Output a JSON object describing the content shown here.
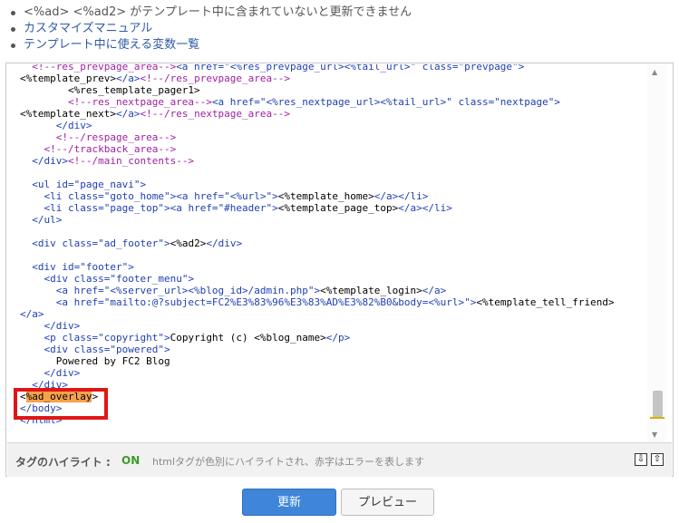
{
  "notes": {
    "warning": "<%ad> <%ad2> がテンプレート中に含まれていないと更新できません",
    "links": [
      "カスタマイズマニュアル",
      "テンプレート中に使える変数一覧"
    ]
  },
  "editor": {
    "lines": [
      {
        "indent": 0,
        "parts": [
          {
            "c": "c",
            "t": "  <!--res_prevpage_area-->"
          },
          {
            "c": "t",
            "t": "<a href="
          },
          {
            "c": "v",
            "t": "\"<%res_prevpage_url><%tail_url>\""
          },
          {
            "c": "t",
            "t": " class="
          },
          {
            "c": "v",
            "t": "\"prevpage\""
          },
          {
            "c": "t",
            "t": ">"
          }
        ]
      },
      {
        "indent": 0,
        "parts": [
          {
            "c": "",
            "t": "<%template_prev>"
          },
          {
            "c": "t",
            "t": "</a>"
          },
          {
            "c": "c",
            "t": "<!--/res_prevpage_area-->"
          }
        ]
      },
      {
        "indent": 0,
        "parts": [
          {
            "c": "",
            "t": "        <%res_template_pager1>"
          }
        ]
      },
      {
        "indent": 0,
        "parts": [
          {
            "c": "c",
            "t": "        <!--res_nextpage_area-->"
          },
          {
            "c": "t",
            "t": "<a href="
          },
          {
            "c": "v",
            "t": "\"<%res_nextpage_url><%tail_url>\""
          },
          {
            "c": "t",
            "t": " class="
          },
          {
            "c": "v",
            "t": "\"nextpage\""
          },
          {
            "c": "t",
            "t": ">"
          }
        ]
      },
      {
        "indent": 0,
        "parts": [
          {
            "c": "",
            "t": "<%template_next>"
          },
          {
            "c": "t",
            "t": "</a>"
          },
          {
            "c": "c",
            "t": "<!--/res_nextpage_area-->"
          }
        ]
      },
      {
        "indent": 0,
        "parts": [
          {
            "c": "t",
            "t": "      </div>"
          }
        ]
      },
      {
        "indent": 0,
        "parts": [
          {
            "c": "c",
            "t": "      <!--/respage_area-->"
          }
        ]
      },
      {
        "indent": 0,
        "parts": [
          {
            "c": "c",
            "t": "    <!--/trackback_area-->"
          }
        ]
      },
      {
        "indent": 0,
        "parts": [
          {
            "c": "t",
            "t": "  </div>"
          },
          {
            "c": "c",
            "t": "<!--/main_contents-->"
          }
        ]
      },
      {
        "indent": 0,
        "parts": []
      },
      {
        "indent": 0,
        "parts": [
          {
            "c": "t",
            "t": "  <ul id="
          },
          {
            "c": "v",
            "t": "\"page_navi\""
          },
          {
            "c": "t",
            "t": ">"
          }
        ]
      },
      {
        "indent": 0,
        "parts": [
          {
            "c": "t",
            "t": "    <li class="
          },
          {
            "c": "v",
            "t": "\"goto_home\""
          },
          {
            "c": "t",
            "t": "><a href="
          },
          {
            "c": "v",
            "t": "\"<%url>\""
          },
          {
            "c": "t",
            "t": ">"
          },
          {
            "c": "",
            "t": "<%template_home>"
          },
          {
            "c": "t",
            "t": "</a></li>"
          }
        ]
      },
      {
        "indent": 0,
        "parts": [
          {
            "c": "t",
            "t": "    <li class="
          },
          {
            "c": "v",
            "t": "\"page_top\""
          },
          {
            "c": "t",
            "t": "><a href="
          },
          {
            "c": "v",
            "t": "\"#header\""
          },
          {
            "c": "t",
            "t": ">"
          },
          {
            "c": "",
            "t": "<%template_page_top>"
          },
          {
            "c": "t",
            "t": "</a></li>"
          }
        ]
      },
      {
        "indent": 0,
        "parts": [
          {
            "c": "t",
            "t": "  </ul>"
          }
        ]
      },
      {
        "indent": 0,
        "parts": []
      },
      {
        "indent": 0,
        "parts": [
          {
            "c": "t",
            "t": "  <div class="
          },
          {
            "c": "v",
            "t": "\"ad_footer\""
          },
          {
            "c": "t",
            "t": ">"
          },
          {
            "c": "",
            "t": "<%ad2>"
          },
          {
            "c": "t",
            "t": "</div>"
          }
        ]
      },
      {
        "indent": 0,
        "parts": []
      },
      {
        "indent": 0,
        "parts": [
          {
            "c": "t",
            "t": "  <div id="
          },
          {
            "c": "v",
            "t": "\"footer\""
          },
          {
            "c": "t",
            "t": ">"
          }
        ]
      },
      {
        "indent": 0,
        "parts": [
          {
            "c": "t",
            "t": "    <div class="
          },
          {
            "c": "v",
            "t": "\"footer_menu\""
          },
          {
            "c": "t",
            "t": ">"
          }
        ]
      },
      {
        "indent": 0,
        "parts": [
          {
            "c": "t",
            "t": "      <a href="
          },
          {
            "c": "v",
            "t": "\"<%server_url><%blog_id>/admin.php\""
          },
          {
            "c": "t",
            "t": ">"
          },
          {
            "c": "",
            "t": "<%template_login>"
          },
          {
            "c": "t",
            "t": "</a>"
          }
        ]
      },
      {
        "indent": 0,
        "parts": [
          {
            "c": "t",
            "t": "      <a href="
          },
          {
            "c": "v",
            "t": "\"mailto:@?subject=FC2%E3%83%96%E3%83%AD%E3%82%B0&body=<%url>\""
          },
          {
            "c": "t",
            "t": ">"
          },
          {
            "c": "",
            "t": "<%template_tell_friend>"
          }
        ]
      },
      {
        "indent": 0,
        "parts": [
          {
            "c": "t",
            "t": "</a>"
          }
        ]
      },
      {
        "indent": 0,
        "parts": [
          {
            "c": "t",
            "t": "    </div>"
          }
        ]
      },
      {
        "indent": 0,
        "parts": [
          {
            "c": "t",
            "t": "    <p class="
          },
          {
            "c": "v",
            "t": "\"copyright\""
          },
          {
            "c": "t",
            "t": ">"
          },
          {
            "c": "",
            "t": "Copyright (c) <%blog_name>"
          },
          {
            "c": "t",
            "t": "</p>"
          }
        ]
      },
      {
        "indent": 0,
        "parts": [
          {
            "c": "t",
            "t": "    <div class="
          },
          {
            "c": "v",
            "t": "\"powered\""
          },
          {
            "c": "t",
            "t": ">"
          }
        ]
      },
      {
        "indent": 0,
        "parts": [
          {
            "c": "",
            "t": "      Powered by FC2 Blog"
          }
        ]
      },
      {
        "indent": 0,
        "parts": [
          {
            "c": "t",
            "t": "    </div>"
          }
        ]
      },
      {
        "indent": 0,
        "parts": [
          {
            "c": "t",
            "t": "  </div>"
          }
        ]
      },
      {
        "indent": 0,
        "parts": [
          {
            "c": "",
            "t": "<"
          },
          {
            "c": "hl",
            "t": "%ad_overlay"
          },
          {
            "c": "",
            "t": ">"
          }
        ]
      },
      {
        "indent": 0,
        "parts": [
          {
            "c": "t",
            "t": "</body>"
          }
        ]
      },
      {
        "indent": 0,
        "parts": [
          {
            "c": "t",
            "t": "</html>"
          }
        ]
      }
    ]
  },
  "highlight_bar": {
    "label": "タグのハイライト :",
    "state": "ON",
    "description": "htmlタグが色別にハイライトされ、赤字はエラーを表します"
  },
  "buttons": {
    "save": "更新",
    "preview": "プレビュー"
  },
  "icons": {
    "scroll_down": "arrow-down-icon",
    "scroll_up": "arrow-up-icon"
  }
}
